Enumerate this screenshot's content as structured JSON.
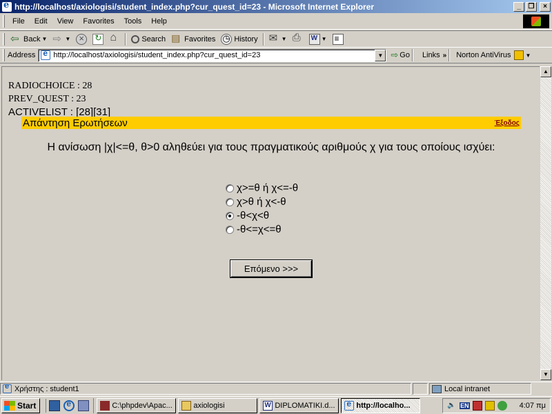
{
  "window": {
    "title": "http://localhost/axiologisi/student_index.php?cur_quest_id=23 - Microsoft Internet Explorer",
    "btn_minimize": "_",
    "btn_maximize": "❐",
    "btn_close": "×"
  },
  "menu": {
    "items": [
      "File",
      "Edit",
      "View",
      "Favorites",
      "Tools",
      "Help"
    ]
  },
  "toolbar": {
    "back": "Back",
    "search": "Search",
    "favorites": "Favorites",
    "history": "History"
  },
  "address": {
    "label": "Address",
    "url": "http://localhost/axiologisi/student_index.php?cur_quest_id=23",
    "go": "Go",
    "links": "Links",
    "norton": "Norton AntiVirus"
  },
  "page": {
    "debug_radiochoice": "RADIOCHOICE : 28",
    "debug_prev_quest": "PREV_QUEST : 23",
    "debug_activelist": "ACTIVELIST : [28][31]",
    "section_title": "Απάντηση Ερωτήσεων",
    "exit_link": "Έξοδος",
    "question": "Η ανίσωση |χ|<=θ, θ>0 αληθεύει για τους πραγματικούς αριθμούς χ για τους οποίους ισχύει:",
    "options": [
      {
        "label": "χ>=θ ή χ<=-θ",
        "checked": false
      },
      {
        "label": "χ>θ ή χ<-θ",
        "checked": false
      },
      {
        "label": "-θ<χ<θ",
        "checked": true
      },
      {
        "label": "-θ<=χ<=θ",
        "checked": false
      }
    ],
    "next_button": "Επόμενο >>>"
  },
  "status": {
    "text": "Χρήστης : student1",
    "zone": "Local intranet"
  },
  "taskbar": {
    "start": "Start",
    "tasks": [
      {
        "label": "C:\\phpdev\\Apac...",
        "icon": "php-icon",
        "active": false
      },
      {
        "label": "axiologisi",
        "icon": "folder-icon",
        "active": false
      },
      {
        "label": "DIPLOMATIKI.d...",
        "icon": "word-icon",
        "active": false
      },
      {
        "label": "http://localho...",
        "icon": "ie-icon",
        "active": true
      }
    ],
    "lang": "EN",
    "clock": "4:07 πμ"
  }
}
